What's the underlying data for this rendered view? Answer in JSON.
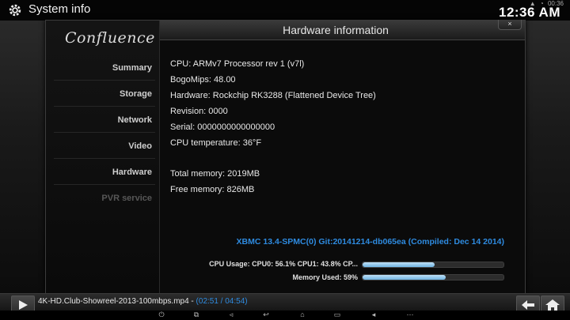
{
  "topbar": {
    "title": "System info",
    "clock": "12:36 AM",
    "status_time": "00:36"
  },
  "sidebar": {
    "logo": "Confluence",
    "items": [
      {
        "label": "Summary",
        "enabled": true
      },
      {
        "label": "Storage",
        "enabled": true
      },
      {
        "label": "Network",
        "enabled": true
      },
      {
        "label": "Video",
        "enabled": true
      },
      {
        "label": "Hardware",
        "enabled": true
      },
      {
        "label": "PVR service",
        "enabled": false
      }
    ]
  },
  "dialog": {
    "title": "Hardware information",
    "close_label": "×",
    "info": [
      "CPU: ARMv7 Processor rev 1 (v7l)",
      "BogoMips: 48.00",
      "Hardware: Rockchip RK3288 (Flattened Device Tree)",
      "Revision: 0000",
      "Serial: 0000000000000000",
      "CPU temperature: 36°F"
    ],
    "memory": [
      "Total memory: 2019MB",
      "Free memory: 826MB"
    ],
    "version": "XBMC 13.4-SPMC(0) Git:20141214-db065ea (Compiled: Dec 14 2014)",
    "cpu_usage_label": "CPU Usage: CPU0: 56.1% CPU1: 43.8% CP...",
    "cpu_usage_fraction": 0.51,
    "memory_used_label": "Memory Used: 59%",
    "memory_used_fraction": 0.59
  },
  "now_playing": {
    "file": "4K-HD.Club-Showreel-2013-100mbps.mp4",
    "separator": " - ",
    "time": "(02:51 / 04:54)"
  },
  "colors": {
    "accent": "#2e8be0",
    "bar_fill": "#8ec8ec"
  }
}
